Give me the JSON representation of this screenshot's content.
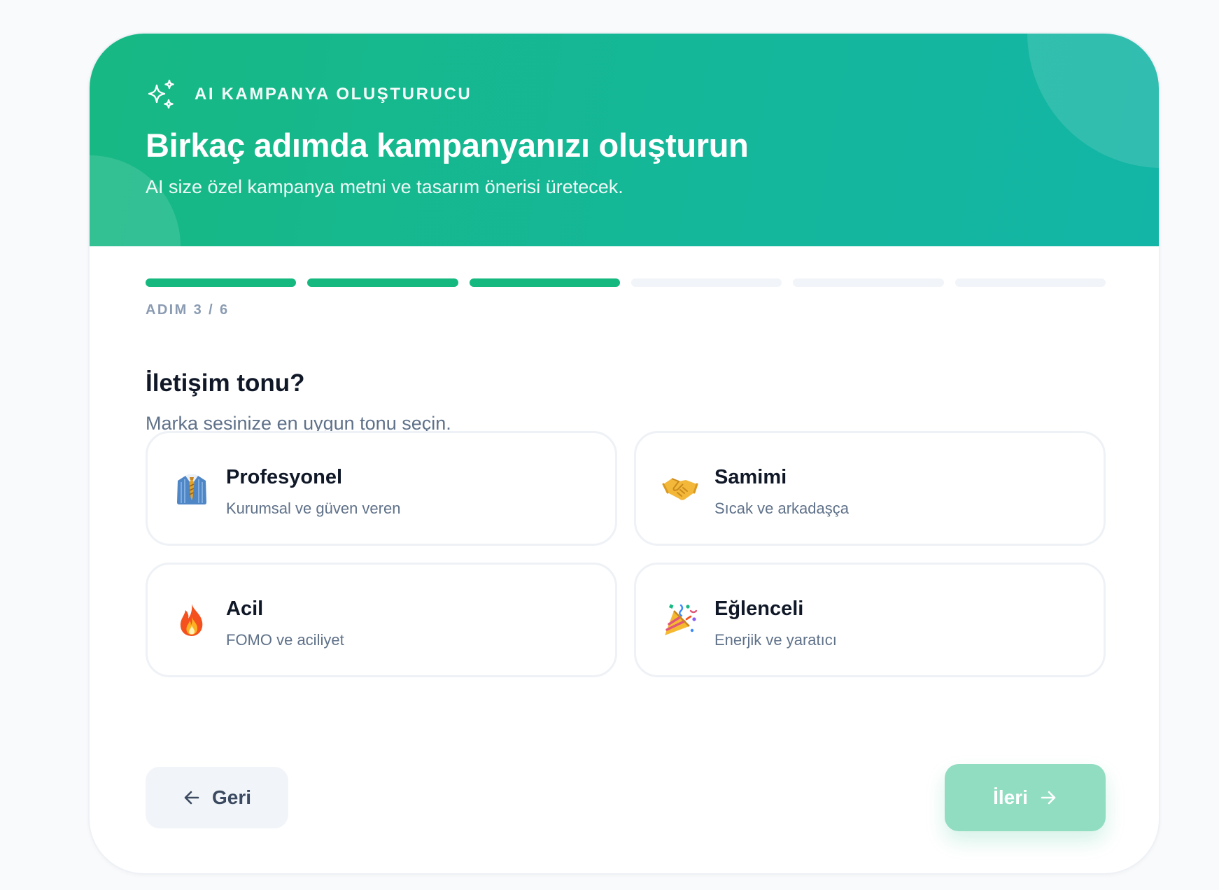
{
  "header": {
    "eyebrow": "AI KAMPANYA OLUŞTURUCU",
    "title": "Birkaç adımda kampanyanızı oluşturun",
    "subtitle": "AI size özel kampanya metni ve tasarım önerisi üretecek.",
    "icon": "sparkles-icon"
  },
  "progress": {
    "current_step": 3,
    "total_steps": 6,
    "label": "ADIM 3 / 6"
  },
  "question": {
    "title": "İletişim tonu?",
    "subtitle": "Marka sesinize en uygun tonu seçin."
  },
  "options": [
    {
      "emoji": "👔",
      "icon": "necktie-icon",
      "title": "Profesyonel",
      "description": "Kurumsal ve güven veren"
    },
    {
      "emoji": "🤝",
      "icon": "handshake-icon",
      "title": "Samimi",
      "description": "Sıcak ve arkadaşça"
    },
    {
      "emoji": "🔥",
      "icon": "fire-icon",
      "title": "Acil",
      "description": "FOMO ve aciliyet"
    },
    {
      "emoji": "🎉",
      "icon": "party-popper-icon",
      "title": "Eğlenceli",
      "description": "Enerjik ve yaratıcı"
    }
  ],
  "actions": {
    "back_label": "Geri",
    "next_label": "İleri",
    "next_enabled": false
  },
  "colors": {
    "brand": "#15b97f",
    "brand_teal": "#13b5a6",
    "progress_inactive": "#f1f4f8",
    "next_disabled": "#90ddc1",
    "text_dark": "#101828",
    "text_muted": "#5f7189"
  }
}
